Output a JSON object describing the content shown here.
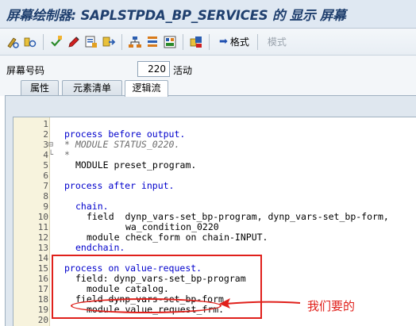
{
  "window": {
    "title": "屏幕绘制器: SAPLSTPDA_BP_SERVICES 的 显示 屏幕"
  },
  "toolbar": {
    "format_label": "格式",
    "mode_label": "模式"
  },
  "screen": {
    "number_label": "屏幕号码",
    "number_value": "220",
    "status": "活动"
  },
  "tabs": [
    {
      "label": "属性"
    },
    {
      "label": "元素清单"
    },
    {
      "label": "逻辑流"
    }
  ],
  "editor": {
    "lines": [
      {
        "n": "1",
        "text": ""
      },
      {
        "n": "2",
        "text": "process before output."
      },
      {
        "n": "3",
        "text": "* MODULE STATUS_0220."
      },
      {
        "n": "4",
        "text": "*"
      },
      {
        "n": "5",
        "text": "MODULE preset_program."
      },
      {
        "n": "6",
        "text": ""
      },
      {
        "n": "7",
        "text": "process after input."
      },
      {
        "n": "8",
        "text": ""
      },
      {
        "n": "9",
        "text": "chain."
      },
      {
        "n": "10",
        "text": "field  dynp_vars-set_bp-program, dynp_vars-set_bp-form,"
      },
      {
        "n": "11",
        "text": "wa_condition_0220"
      },
      {
        "n": "12",
        "text": "module check_form on chain-INPUT."
      },
      {
        "n": "13",
        "text": "endchain."
      },
      {
        "n": "14",
        "text": ""
      },
      {
        "n": "15",
        "text": "process on value-request."
      },
      {
        "n": "16",
        "text": "field: dynp_vars-set_bp-program"
      },
      {
        "n": "17",
        "text": "module catalog."
      },
      {
        "n": "18",
        "text": "field dynp_vars-set_bp-form"
      },
      {
        "n": "19",
        "text": "module value_request_frm."
      },
      {
        "n": "20",
        "text": ""
      }
    ]
  },
  "annotation": {
    "text": "我们要的"
  },
  "colors": {
    "keyword": "#0000cc",
    "comment": "#6d6d6d",
    "annotation": "#e0201b",
    "title": "#1f3f6e"
  }
}
